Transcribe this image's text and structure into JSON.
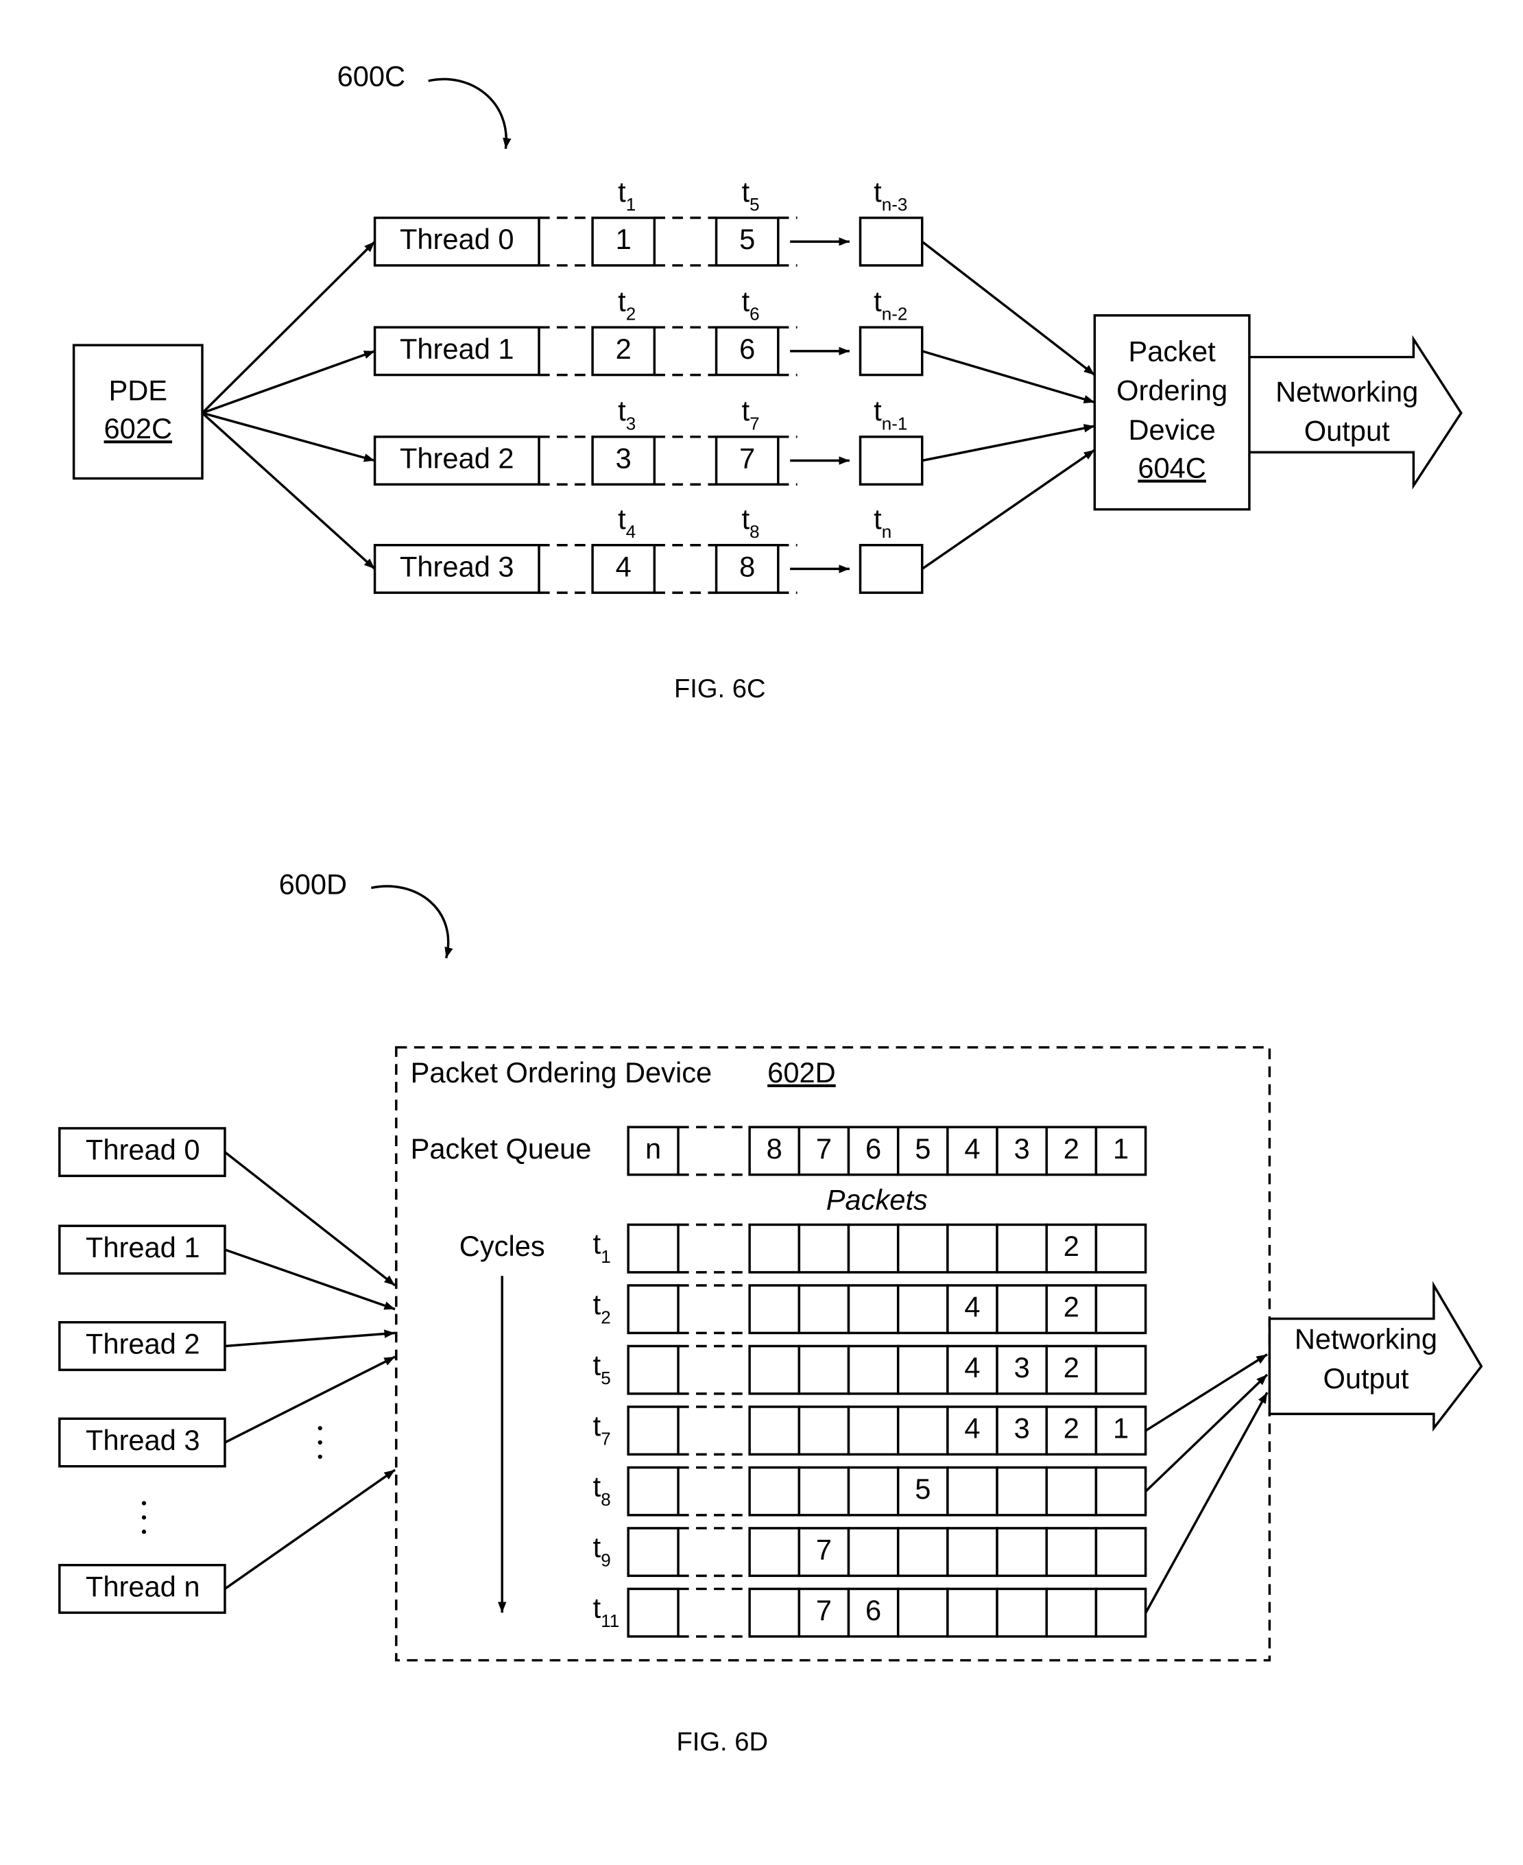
{
  "fig6c": {
    "ref": "600C",
    "caption": "FIG. 6C",
    "pde": {
      "name": "PDE",
      "ref": "602C"
    },
    "threads": [
      {
        "label": "Thread 0",
        "packets": [
          "1",
          "5"
        ],
        "times": [
          {
            "base": "t",
            "sub": "1"
          },
          {
            "base": "t",
            "sub": "5"
          },
          {
            "base": "t",
            "sub": "n-3"
          }
        ]
      },
      {
        "label": "Thread 1",
        "packets": [
          "2",
          "6"
        ],
        "times": [
          {
            "base": "t",
            "sub": "2"
          },
          {
            "base": "t",
            "sub": "6"
          },
          {
            "base": "t",
            "sub": "n-2"
          }
        ]
      },
      {
        "label": "Thread 2",
        "packets": [
          "3",
          "7"
        ],
        "times": [
          {
            "base": "t",
            "sub": "3"
          },
          {
            "base": "t",
            "sub": "7"
          },
          {
            "base": "t",
            "sub": "n-1"
          }
        ]
      },
      {
        "label": "Thread 3",
        "packets": [
          "4",
          "8"
        ],
        "times": [
          {
            "base": "t",
            "sub": "4"
          },
          {
            "base": "t",
            "sub": "8"
          },
          {
            "base": "t",
            "sub": "n"
          }
        ]
      }
    ],
    "ordering_device": {
      "lines": [
        "Packet",
        "Ordering",
        "Device"
      ],
      "ref": "604C"
    },
    "output": [
      "Networking",
      "Output"
    ]
  },
  "fig6d": {
    "ref": "600D",
    "caption": "FIG. 6D",
    "device_title": "Packet Ordering Device",
    "device_ref": "602D",
    "threads": [
      "Thread 0",
      "Thread 1",
      "Thread 2",
      "Thread 3",
      "Thread n"
    ],
    "queue_label": "Packet Queue",
    "queue_first": "n",
    "queue": [
      "8",
      "7",
      "6",
      "5",
      "4",
      "3",
      "2",
      "1"
    ],
    "packets_label": "Packets",
    "cycles_label": "Cycles",
    "cycles": [
      {
        "t": {
          "base": "t",
          "sub": "1"
        },
        "cells": [
          "",
          "",
          "",
          "",
          "",
          "",
          "2",
          ""
        ]
      },
      {
        "t": {
          "base": "t",
          "sub": "2"
        },
        "cells": [
          "",
          "",
          "",
          "",
          "4",
          "",
          "2",
          ""
        ]
      },
      {
        "t": {
          "base": "t",
          "sub": "5"
        },
        "cells": [
          "",
          "",
          "",
          "",
          "4",
          "3",
          "2",
          ""
        ]
      },
      {
        "t": {
          "base": "t",
          "sub": "7"
        },
        "cells": [
          "",
          "",
          "",
          "",
          "4",
          "3",
          "2",
          "1"
        ]
      },
      {
        "t": {
          "base": "t",
          "sub": "8"
        },
        "cells": [
          "",
          "",
          "",
          "5",
          "",
          "",
          "",
          ""
        ]
      },
      {
        "t": {
          "base": "t",
          "sub": "9"
        },
        "cells": [
          "",
          "7",
          "",
          "",
          "",
          "",
          "",
          ""
        ]
      },
      {
        "t": {
          "base": "t",
          "sub": "11"
        },
        "cells": [
          "",
          "7",
          "6",
          "",
          "",
          "",
          "",
          ""
        ]
      }
    ],
    "output": [
      "Networking",
      "Output"
    ]
  }
}
